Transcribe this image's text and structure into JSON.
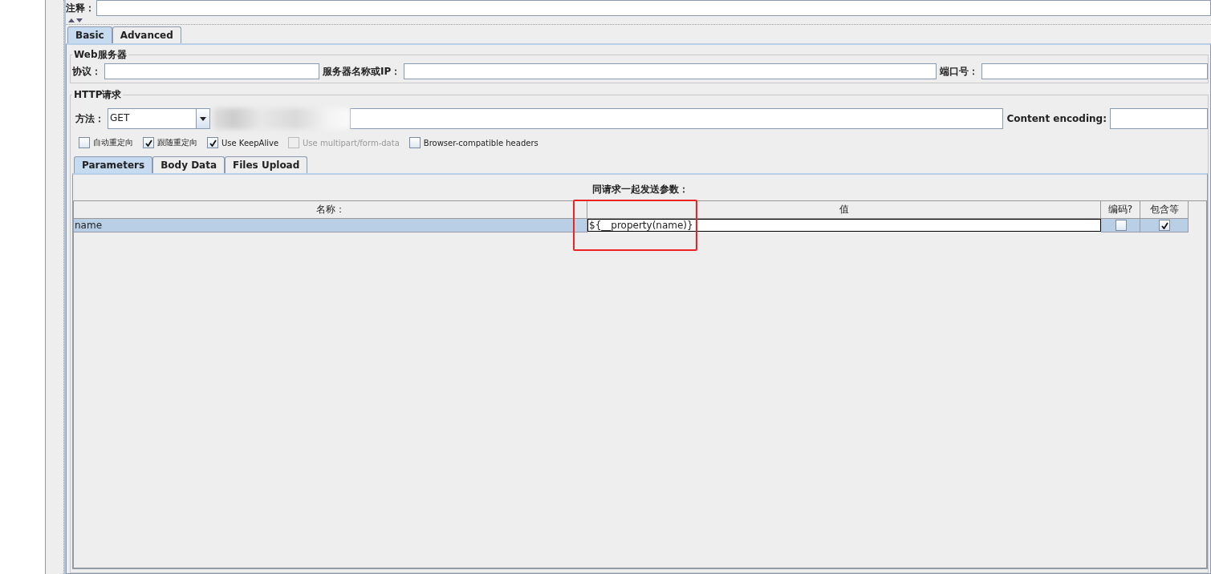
{
  "comment": {
    "label": "注释："
  },
  "tabs": [
    {
      "label": "Basic",
      "selected": true
    },
    {
      "label": "Advanced",
      "selected": false
    }
  ],
  "web_server": {
    "title": "Web服务器",
    "protocol_label": "协议：",
    "server_label": "服务器名称或IP：",
    "port_label": "端口号："
  },
  "http_request": {
    "title": "HTTP请求",
    "method_label": "方法：",
    "method": "GET",
    "encoding_label": "Content encoding:"
  },
  "options": [
    {
      "label": "自动重定向",
      "checked": false,
      "disabled": false
    },
    {
      "label": "跟随重定向",
      "checked": true,
      "disabled": false
    },
    {
      "label": "Use KeepAlive",
      "checked": true,
      "disabled": false
    },
    {
      "label": "Use multipart/form-data",
      "checked": false,
      "disabled": true
    },
    {
      "label": "Browser-compatible headers",
      "checked": false,
      "disabled": false
    }
  ],
  "sub_tabs": [
    {
      "label": "Parameters",
      "selected": true
    },
    {
      "label": "Body Data",
      "selected": false
    },
    {
      "label": "Files Upload",
      "selected": false
    }
  ],
  "parameters": {
    "title": "同请求一起发送参数：",
    "columns": [
      "名称：",
      "值",
      "编码?",
      "包含等"
    ],
    "rows": [
      {
        "name": "name",
        "value": "${__property(name)}",
        "encode": false,
        "include": true,
        "selected": true,
        "editing": true
      }
    ]
  }
}
